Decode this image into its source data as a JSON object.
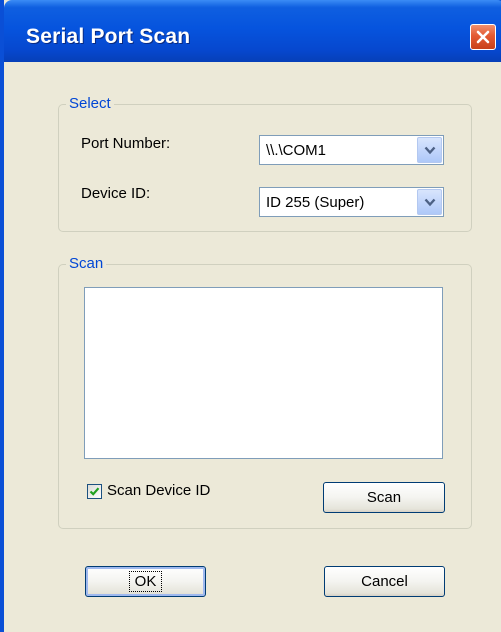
{
  "window": {
    "title": "Serial Port Scan"
  },
  "select_group": {
    "legend": "Select",
    "port_label": "Port Number:",
    "port_value": "\\\\.\\COM1",
    "device_label": "Device ID:",
    "device_value": "ID 255 (Super)"
  },
  "scan_group": {
    "legend": "Scan",
    "results": [],
    "checkbox_label": "Scan Device ID",
    "checkbox_checked": true,
    "scan_button": "Scan"
  },
  "buttons": {
    "ok": "OK",
    "cancel": "Cancel"
  },
  "colors": {
    "titlebar": "#0654de",
    "dialog_bg": "#ece9d8",
    "legend_text": "#0046d5",
    "close_button": "#e35a32",
    "checkmark": "#21a121"
  },
  "icons": {
    "close": "close-icon",
    "dropdown": "chevron-down-icon",
    "check": "checkmark-icon"
  }
}
